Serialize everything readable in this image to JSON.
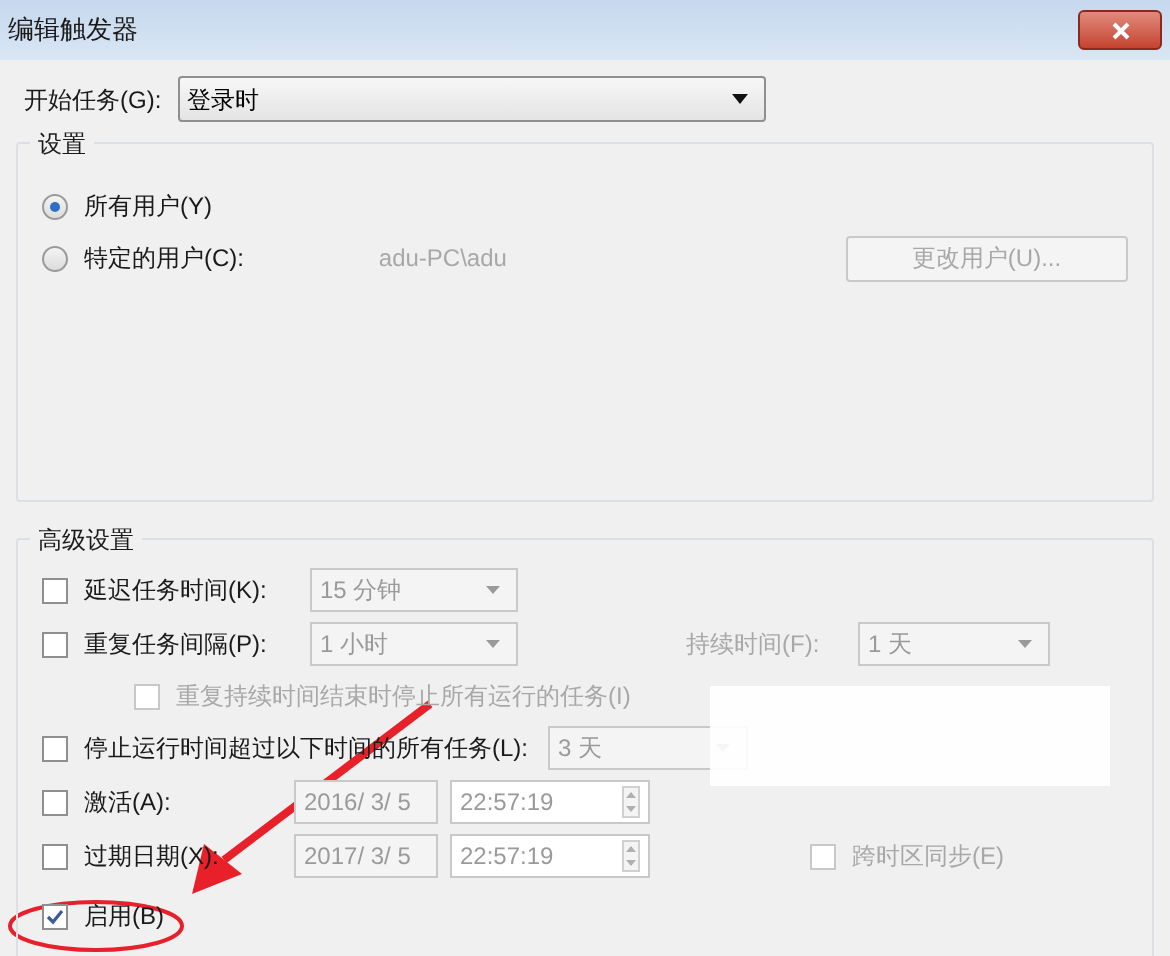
{
  "window": {
    "title": "编辑触发器"
  },
  "start_task": {
    "label": "开始任务(G):",
    "value": "登录时"
  },
  "settings": {
    "title": "设置",
    "options": [
      {
        "label": "所有用户(Y)",
        "selected": true
      },
      {
        "label": "特定的用户(C):",
        "selected": false
      }
    ],
    "user": "adu-PC\\adu",
    "change_user_button": {
      "label": "更改用户(U)...",
      "disabled": true
    }
  },
  "advanced": {
    "title": "高级设置",
    "delay": {
      "label": "延迟任务时间(K):",
      "checked": false,
      "value": "15 分钟"
    },
    "repeat": {
      "label": "重复任务间隔(P):",
      "checked": false,
      "value": "1 小时",
      "duration_label": "持续时间(F):",
      "duration_value": "1 天"
    },
    "stop_repeat": {
      "label": "重复持续时间结束时停止所有运行的任务(I)",
      "checked": false,
      "disabled": true
    },
    "stop_longer": {
      "label": "停止运行时间超过以下时间的所有任务(L):",
      "checked": false,
      "value": "3 天"
    },
    "activate": {
      "label": "激活(A):",
      "checked": false,
      "date": "2016/ 3/ 5",
      "time": "22:57:19"
    },
    "expire": {
      "label": "过期日期(X):",
      "checked": false,
      "date": "2017/ 3/ 5",
      "time": "22:57:19",
      "sync_label": "跨时区同步(E)",
      "sync_checked": false
    },
    "enabled": {
      "label": "启用(B)",
      "checked": true
    }
  }
}
